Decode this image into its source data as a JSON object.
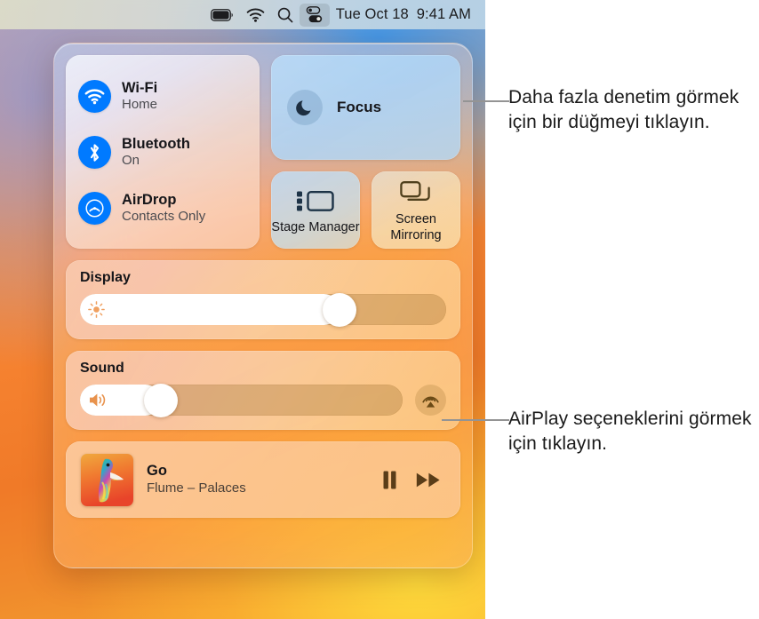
{
  "menubar": {
    "items": [
      {
        "name": "battery-icon",
        "label": "Battery"
      },
      {
        "name": "wifi-icon",
        "label": "Wi-Fi"
      },
      {
        "name": "spotlight-search-icon",
        "label": "Spotlight Search"
      },
      {
        "name": "control-center-icon",
        "label": "Control Center"
      }
    ],
    "date": "Tue Oct 18",
    "time": "9:41 AM"
  },
  "control_center": {
    "connectivity": {
      "items": [
        {
          "title": "Wi-Fi",
          "status": "Home",
          "icon": "wifi-icon"
        },
        {
          "title": "Bluetooth",
          "status": "On",
          "icon": "bluetooth-icon"
        },
        {
          "title": "AirDrop",
          "status": "Contacts Only",
          "icon": "airdrop-icon"
        }
      ]
    },
    "focus": {
      "label": "Focus",
      "icon": "moon-icon"
    },
    "tiles": [
      {
        "label": "Stage Manager",
        "icon": "stage-manager-icon"
      },
      {
        "label": "Screen Mirroring",
        "icon": "screen-mirroring-icon"
      }
    ],
    "display": {
      "title": "Display",
      "icon": "brightness-icon",
      "value_percent": 73
    },
    "sound": {
      "title": "Sound",
      "icon": "volume-icon",
      "value_percent": 22,
      "airplay_icon": "airplay-icon"
    },
    "now_playing": {
      "track": "Go",
      "artist_album": "Flume – Palaces",
      "album_art": "flume-palaces-artwork",
      "pause_icon": "pause-icon",
      "forward_icon": "fast-forward-icon"
    }
  },
  "callouts": [
    {
      "text": "Daha fazla denetim görmek için bir düğmeyi tıklayın."
    },
    {
      "text": "AirPlay seçeneklerini görmek için tıklayın."
    }
  ],
  "colors": {
    "accent_blue": "#007aff",
    "leader_line": "#949494",
    "text_primary": "#16161a"
  }
}
